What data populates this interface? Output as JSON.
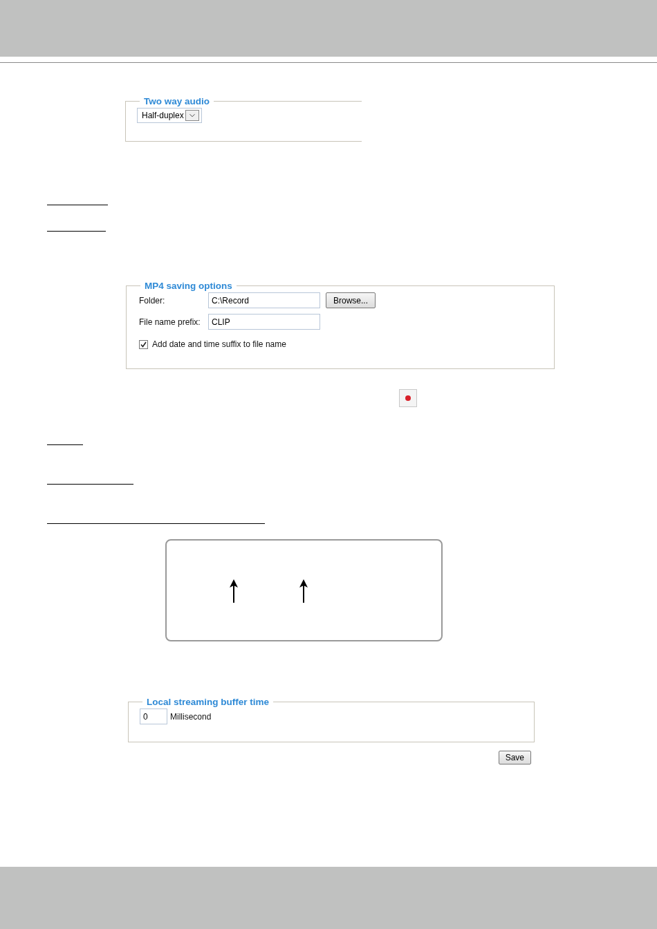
{
  "two_way_audio": {
    "title": "Two way audio",
    "mode": "Half-duplex"
  },
  "mp4_saving_options": {
    "title": "MP4 saving options",
    "fields": [
      {
        "label": "Folder:",
        "value": "C:\\Record",
        "button": "Browse..."
      },
      {
        "label": "File name prefix:",
        "value": "CLIP"
      }
    ],
    "suffix_option": {
      "label": "Add date and time suffix to file name",
      "checked": true
    }
  },
  "local_streaming_buffer_time": {
    "title": "Local streaming buffer time",
    "value": "0",
    "unit": "Millisecond"
  },
  "save_button": "Save"
}
